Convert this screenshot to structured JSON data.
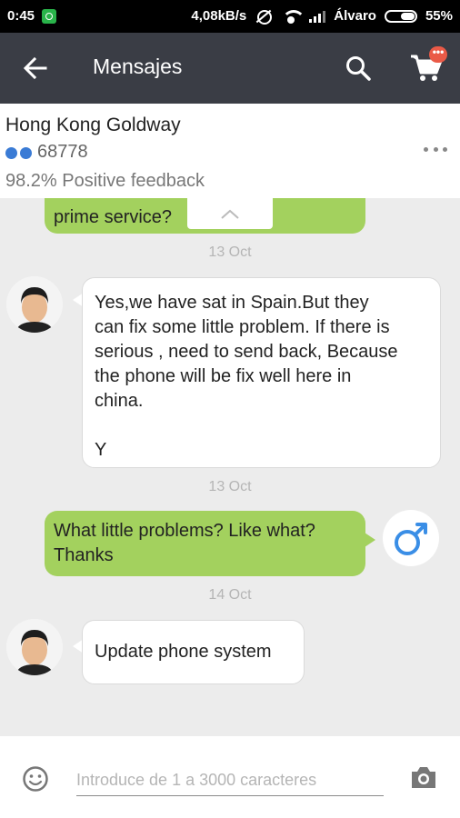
{
  "status_bar": {
    "time": "0:45",
    "speed": "4,08kB/s",
    "carrier": "Álvaro",
    "battery": "55%"
  },
  "header": {
    "title": "Mensajes",
    "cart_badge": "•••"
  },
  "seller": {
    "name": "Hong Kong Goldway",
    "score": "68778",
    "feedback": "98.2%  Positive feedback"
  },
  "chat": {
    "messages": [
      {
        "direction": "outgoing",
        "text": "prime service?"
      },
      {
        "type": "date",
        "text": "13 Oct"
      },
      {
        "direction": "incoming",
        "text": "Yes,we have sat in Spain.But they\ncan fix some little problem. If there is\nserious , need to send back, Because\nthe phone will be fix well here in\nchina.\n\nY"
      },
      {
        "type": "date",
        "text": "13 Oct"
      },
      {
        "direction": "outgoing",
        "text": "What little problems? Like what?\nThanks"
      },
      {
        "type": "date",
        "text": "14 Oct"
      },
      {
        "direction": "incoming",
        "text": "Update phone system"
      }
    ]
  },
  "input": {
    "placeholder": "Introduce de 1 a 3000 caracteres",
    "value": ""
  },
  "colors": {
    "header_bg": "#3a3d45",
    "outgoing_bubble": "#a3d15e",
    "incoming_bubble": "#ffffff",
    "chat_bg": "#ececec",
    "user_avatar_accent": "#3a8ee6"
  },
  "icons": [
    "back-arrow-icon",
    "search-icon",
    "cart-icon",
    "more-options-icon",
    "emoji-icon",
    "camera-icon",
    "male-symbol-icon"
  ]
}
